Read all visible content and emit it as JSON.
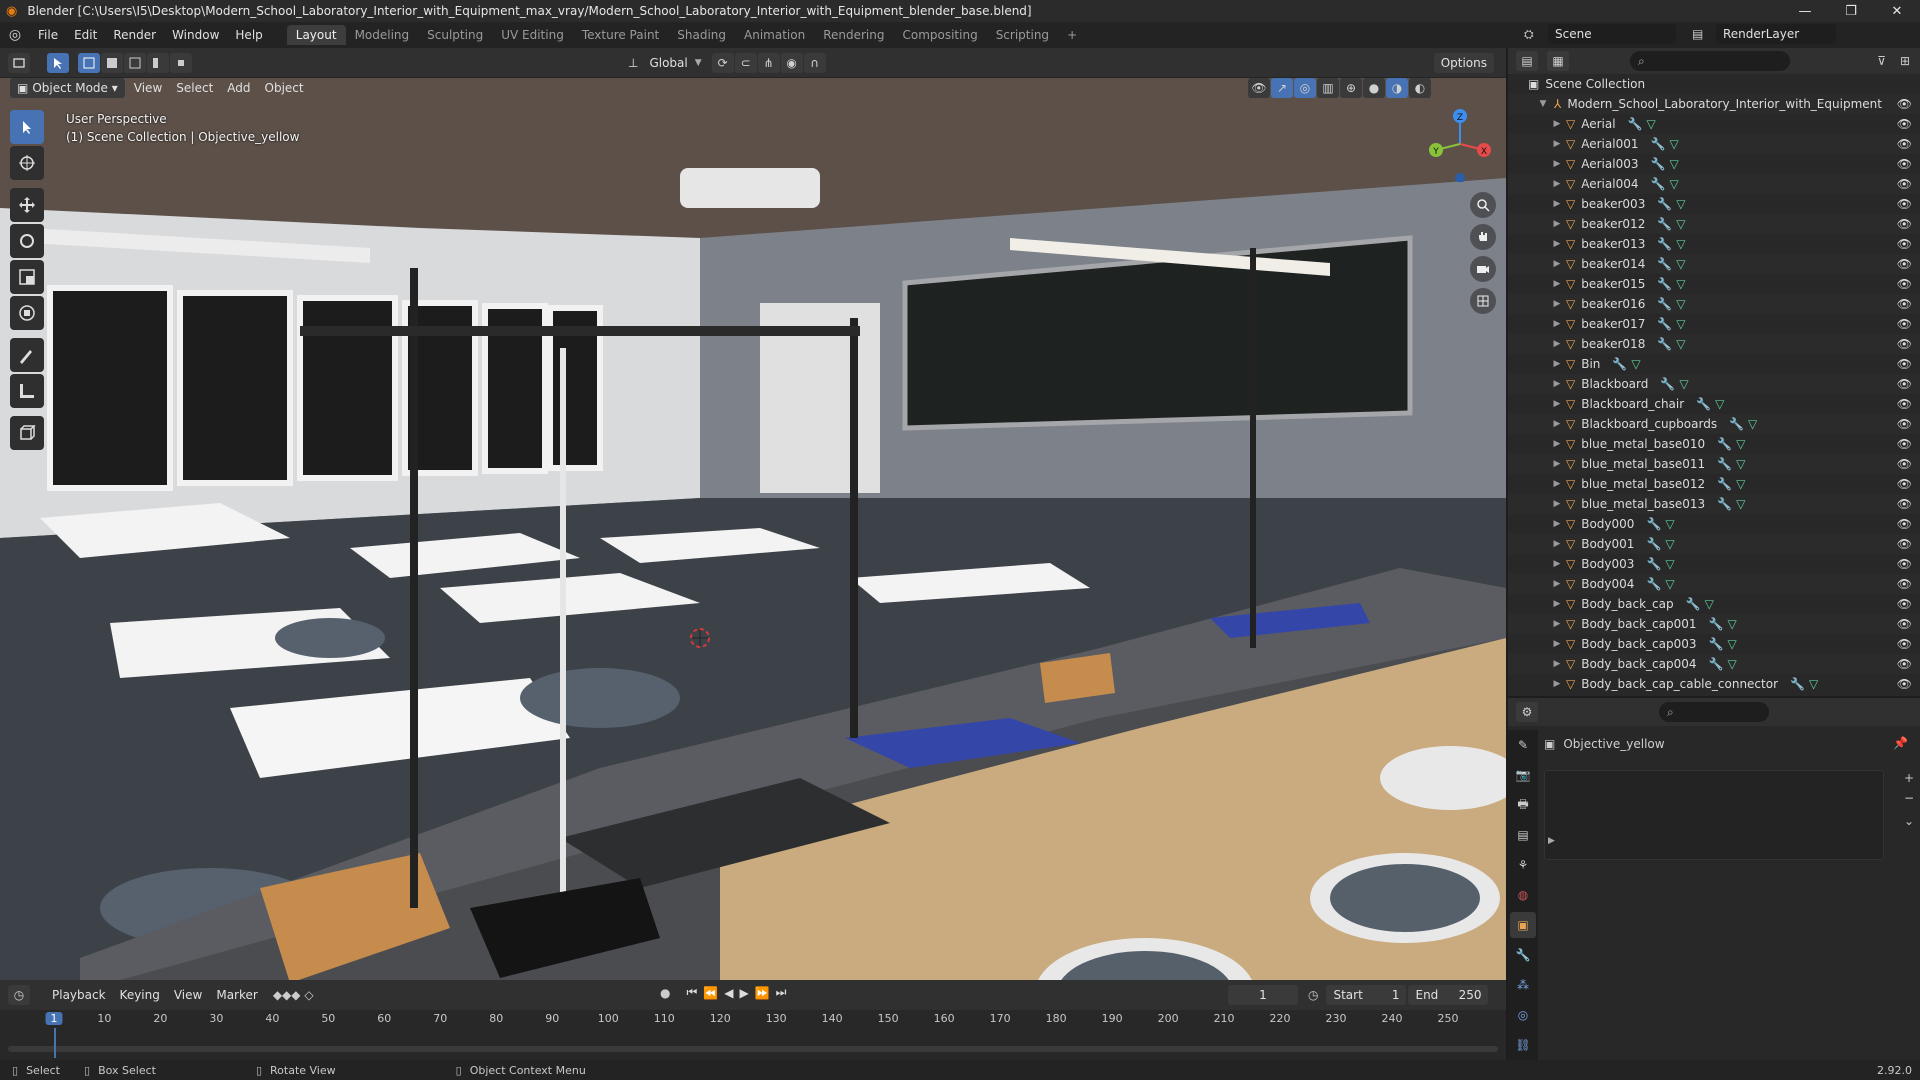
{
  "window": {
    "title": "Blender [C:\\Users\\I5\\Desktop\\Modern_School_Laboratory_Interior_with_Equipment_max_vray/Modern_School_Laboratory_Interior_with_Equipment_blender_base.blend]",
    "minimize": "—",
    "maximize": "❐",
    "close": "✕"
  },
  "menu": [
    "File",
    "Edit",
    "Render",
    "Window",
    "Help"
  ],
  "workspaces": [
    "Layout",
    "Modeling",
    "Sculpting",
    "UV Editing",
    "Texture Paint",
    "Shading",
    "Animation",
    "Rendering",
    "Compositing",
    "Scripting"
  ],
  "workspace_active": "Layout",
  "add_workspace": "+",
  "scene": {
    "name": "Scene",
    "render_layer": "RenderLayer"
  },
  "viewport": {
    "mode": "Object Mode",
    "menus": [
      "View",
      "Select",
      "Add",
      "Object"
    ],
    "orientation": "Global",
    "options": "Options",
    "info_line1": "User Perspective",
    "info_line2": "(1) Scene Collection | Objective_yellow",
    "gizmo_axes": {
      "x": "X",
      "y": "Y",
      "z": "Z"
    }
  },
  "outliner": {
    "search_placeholder": "",
    "root": "Scene Collection",
    "collection": "Modern_School_Laboratory_Interior_with_Equipment",
    "items": [
      "Aerial",
      "Aerial001",
      "Aerial003",
      "Aerial004",
      "beaker003",
      "beaker012",
      "beaker013",
      "beaker014",
      "beaker015",
      "beaker016",
      "beaker017",
      "beaker018",
      "Bin",
      "Blackboard",
      "Blackboard_chair",
      "Blackboard_cupboards",
      "blue_metal_base010",
      "blue_metal_base011",
      "blue_metal_base012",
      "blue_metal_base013",
      "Body000",
      "Body001",
      "Body003",
      "Body004",
      "Body_back_cap",
      "Body_back_cap001",
      "Body_back_cap003",
      "Body_back_cap004",
      "Body_back_cap_cable_connector"
    ]
  },
  "properties": {
    "object_name": "Objective_yellow",
    "search_placeholder": ""
  },
  "timeline": {
    "menus": [
      "Playback",
      "Keying",
      "View",
      "Marker"
    ],
    "current_frame": "1",
    "start_label": "Start",
    "start": "1",
    "end_label": "End",
    "end": "250",
    "ticks": [
      "1",
      "10",
      "20",
      "30",
      "40",
      "50",
      "60",
      "70",
      "80",
      "90",
      "100",
      "110",
      "120",
      "130",
      "140",
      "150",
      "160",
      "170",
      "180",
      "190",
      "200",
      "210",
      "220",
      "230",
      "240",
      "250"
    ]
  },
  "status": {
    "select": "Select",
    "box_select": "Box Select",
    "rotate_view": "Rotate View",
    "context_menu": "Object Context Menu",
    "version": "2.92.0"
  },
  "colors": {
    "accent": "#4772b3",
    "mesh_icon": "#e8a450",
    "modifier_icon": "#7aa7e8",
    "data_icon": "#5fcf9a",
    "axis_x": "#e64a4a",
    "axis_y": "#8ac33a",
    "axis_z": "#3b8ef0"
  }
}
